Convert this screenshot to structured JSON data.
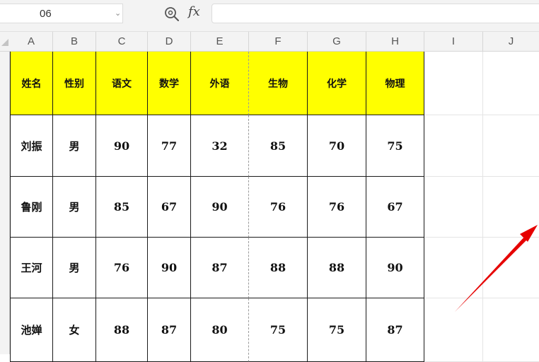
{
  "formula_bar": {
    "name_box_value": "06",
    "fx_label": "fx",
    "formula_value": ""
  },
  "icons": [
    "chevron-down-icon",
    "zoom-icon",
    "fx-icon",
    "arrow-annotation"
  ],
  "columns": [
    "A",
    "B",
    "C",
    "D",
    "E",
    "F",
    "G",
    "H",
    "I",
    "J"
  ],
  "table": {
    "headers": [
      "姓名",
      "性别",
      "语文",
      "数学",
      "外语",
      "生物",
      "化学",
      "物理"
    ],
    "rows": [
      [
        "刘振",
        "男",
        "90",
        "77",
        "32",
        "85",
        "70",
        "75"
      ],
      [
        "鲁刚",
        "男",
        "85",
        "67",
        "90",
        "76",
        "76",
        "67"
      ],
      [
        "王河",
        "男",
        "76",
        "90",
        "87",
        "88",
        "88",
        "90"
      ],
      [
        "池婵",
        "女",
        "88",
        "87",
        "80",
        "75",
        "75",
        "87"
      ]
    ]
  },
  "colors": {
    "header_fill": "#ffff00",
    "annotation_arrow": "#e60000"
  }
}
